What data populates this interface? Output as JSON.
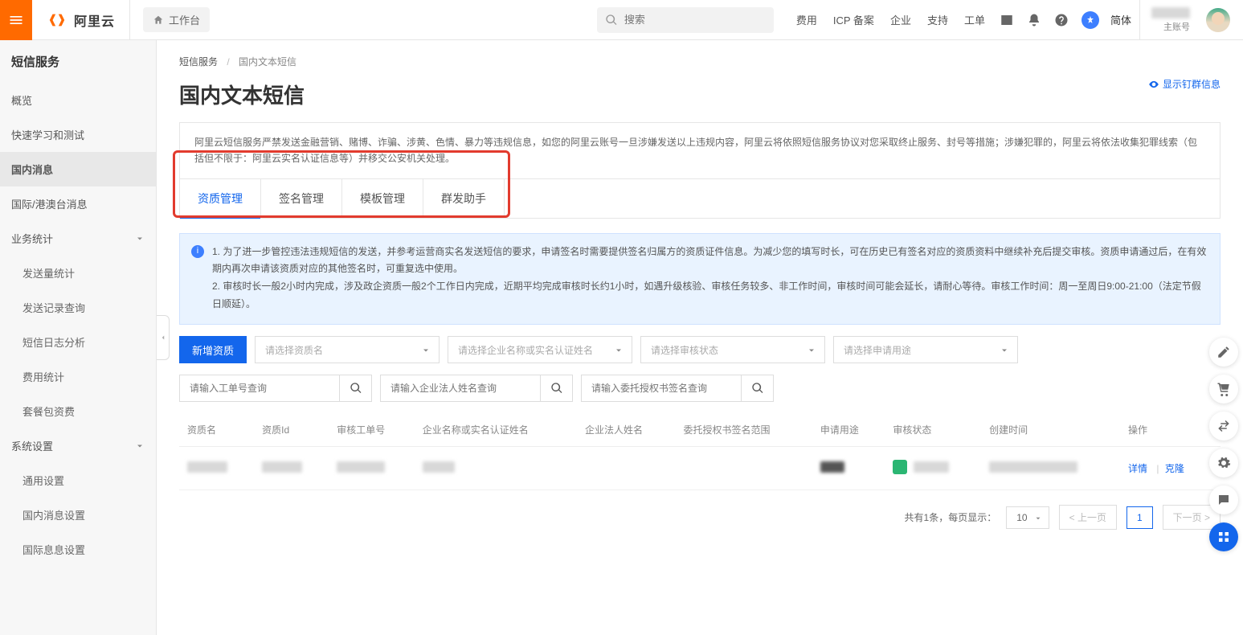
{
  "top": {
    "brand": "阿里云",
    "workbench": "工作台",
    "search_placeholder": "搜索",
    "links": [
      "费用",
      "ICP 备案",
      "企业",
      "支持",
      "工单"
    ],
    "lang": "简体",
    "account_sub": "主账号"
  },
  "sidebar": {
    "title": "短信服务",
    "items": [
      {
        "label": "概览"
      },
      {
        "label": "快速学习和测试"
      },
      {
        "label": "国内消息",
        "active": true
      },
      {
        "label": "国际/港澳台消息"
      },
      {
        "label": "业务统计",
        "expandable": true,
        "open": true
      },
      {
        "label": "发送量统计",
        "sub": true
      },
      {
        "label": "发送记录查询",
        "sub": true
      },
      {
        "label": "短信日志分析",
        "sub": true
      },
      {
        "label": "费用统计",
        "sub": true
      },
      {
        "label": "套餐包资费",
        "sub": true
      },
      {
        "label": "系统设置",
        "expandable": true,
        "open": true
      },
      {
        "label": "通用设置",
        "sub": true
      },
      {
        "label": "国内消息设置",
        "sub": true
      },
      {
        "label": "国际息息设置",
        "sub": true
      }
    ]
  },
  "crumb": {
    "root": "短信服务",
    "leaf": "国内文本短信"
  },
  "page_title": "国内文本短信",
  "show_ding": "显示钉群信息",
  "warning": "阿里云短信服务严禁发送金融营销、赌博、诈骗、涉黄、色情、暴力等违规信息，如您的阿里云账号一旦涉嫌发送以上违规内容，阿里云将依照短信服务协议对您采取终止服务、封号等措施；涉嫌犯罪的，阿里云将依法收集犯罪线索（包括但不限于：阿里云实名认证信息等）并移交公安机关处理。",
  "tabs": [
    "资质管理",
    "签名管理",
    "模板管理",
    "群发助手"
  ],
  "info_lines": [
    "1. 为了进一步管控违法违规短信的发送，并参考运营商实名发送短信的要求，申请签名时需要提供签名归属方的资质证件信息。为减少您的填写时长，可在历史已有签名对应的资质资料中继续补充后提交审核。资质申请通过后，在有效期内再次申请该资质对应的其他签名时，可重复选中使用。",
    "2. 审核时长一般2小时内完成，涉及政企资质一般2个工作日内完成，近期平均完成审核时长约1小时，如遇升级核验、审核任务较多、非工作时间，审核时间可能会延长，请耐心等待。审核工作时间：周一至周日9:00-21:00（法定节假日顺延）。"
  ],
  "controls": {
    "new_btn": "新增资质",
    "sel1": "请选择资质名",
    "sel2": "请选择企业名称或实名认证姓名",
    "sel3": "请选择审核状态",
    "sel4": "请选择申请用途",
    "s1": "请输入工单号查询",
    "s2": "请输入企业法人姓名查询",
    "s3": "请输入委托授权书签名查询"
  },
  "table": {
    "cols": [
      "资质名",
      "资质Id",
      "审核工单号",
      "企业名称或实名认证姓名",
      "企业法人姓名",
      "委托授权书签名范围",
      "申请用途",
      "审核状态",
      "创建时间",
      "操作"
    ],
    "ops": {
      "detail": "详情",
      "clone": "克隆"
    }
  },
  "pager": {
    "total_text": "共有1条，每页显示：",
    "page_size": "10",
    "prev": "上一页",
    "page": "1",
    "next": "下一页"
  }
}
